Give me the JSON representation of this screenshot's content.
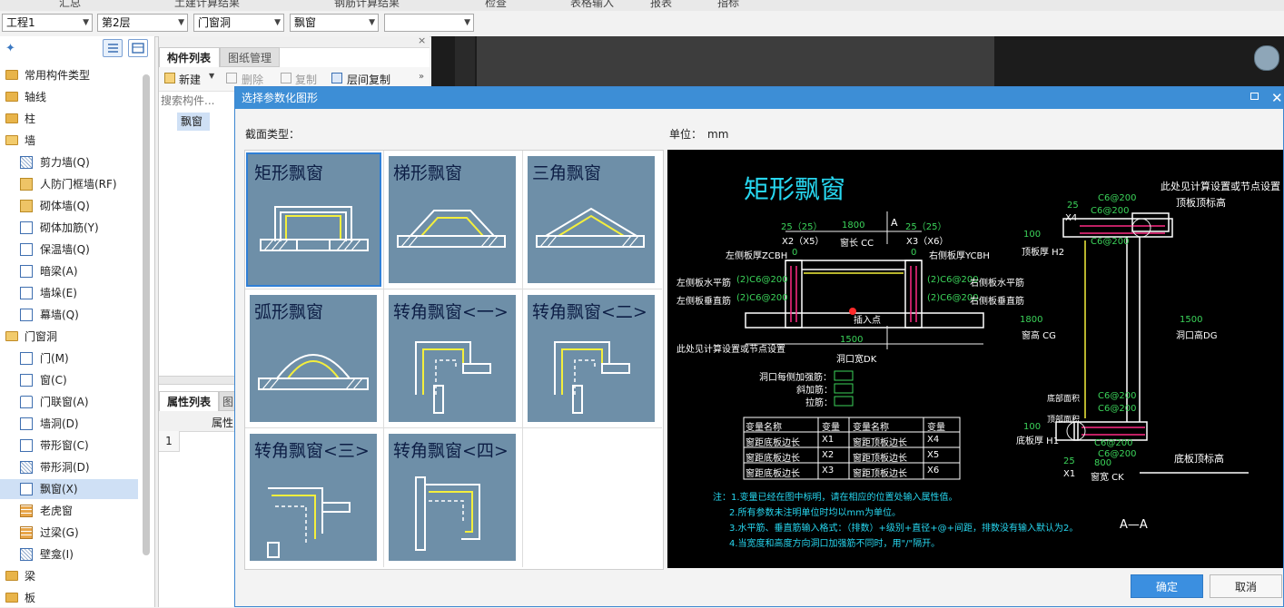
{
  "menubar": [
    "汇总",
    "土建计算结果",
    "钢筋计算结果",
    "检查",
    "表格输入",
    "报表",
    "指标"
  ],
  "toolbar": {
    "combos": [
      "工程1",
      "第2层",
      "门窗洞",
      "飘窗",
      ""
    ]
  },
  "sidebar": {
    "items": [
      {
        "label": "常用构件类型",
        "kind": "folder"
      },
      {
        "label": "轴线",
        "kind": "folder"
      },
      {
        "label": "柱",
        "kind": "folder"
      },
      {
        "label": "墙",
        "kind": "folder-open"
      },
      {
        "label": "剪力墙(Q)",
        "kind": "child"
      },
      {
        "label": "人防门框墙(RF)",
        "kind": "child"
      },
      {
        "label": "砌体墙(Q)",
        "kind": "child"
      },
      {
        "label": "砌体加筋(Y)",
        "kind": "child"
      },
      {
        "label": "保温墙(Q)",
        "kind": "child"
      },
      {
        "label": "暗梁(A)",
        "kind": "child"
      },
      {
        "label": "墙垛(E)",
        "kind": "child"
      },
      {
        "label": "幕墙(Q)",
        "kind": "child"
      },
      {
        "label": "门窗洞",
        "kind": "folder-open"
      },
      {
        "label": "门(M)",
        "kind": "child"
      },
      {
        "label": "窗(C)",
        "kind": "child"
      },
      {
        "label": "门联窗(A)",
        "kind": "child"
      },
      {
        "label": "墙洞(D)",
        "kind": "child"
      },
      {
        "label": "带形窗(C)",
        "kind": "child"
      },
      {
        "label": "带形洞(D)",
        "kind": "child"
      },
      {
        "label": "飘窗(X)",
        "kind": "child",
        "selected": true
      },
      {
        "label": "老虎窗",
        "kind": "child"
      },
      {
        "label": "过梁(G)",
        "kind": "child"
      },
      {
        "label": "壁龛(I)",
        "kind": "child"
      },
      {
        "label": "梁",
        "kind": "folder"
      },
      {
        "label": "板",
        "kind": "folder"
      }
    ]
  },
  "component_panel": {
    "tabs": [
      "构件列表",
      "图纸管理"
    ],
    "toolbar": [
      "新建",
      "删除",
      "复制",
      "层间复制"
    ],
    "search_placeholder": "搜索构件...",
    "items": [
      "飘窗"
    ]
  },
  "property_panel": {
    "tabs": [
      "属性列表",
      "图"
    ],
    "header": "属性",
    "row_number": "1"
  },
  "dialog": {
    "title": "选择参数化图形",
    "section_label": "截面类型：",
    "unit_label": "单位：",
    "unit_value": "mm",
    "shapes": [
      "矩形飘窗",
      "梯形飘窗",
      "三角飘窗",
      "弧形飘窗",
      "转角飘窗<一>",
      "转角飘窗<二>",
      "转角飘窗<三>",
      "转角飘窗<四>"
    ],
    "selected_shape": "矩形飘窗",
    "ok_button": "确定",
    "cancel_button": "取消"
  },
  "preview": {
    "title": "矩形飘窗",
    "top_right_note": "此处见计算设置或节点设置",
    "top_slab_label": "顶板顶标高",
    "labels": {
      "dim_25_25": "25（25）",
      "x2x5": "X2（X5）",
      "dim_1800": "1800",
      "cc": "窗长 CC",
      "x3x6": "X3（X6）",
      "section_a": "A",
      "left_thick": "左侧板厚ZCBH",
      "right_thick": "右侧板厚YCBH",
      "zero": "0",
      "left_h": "左侧板水平筋",
      "left_v": "左侧板垂直筋",
      "right_h": "右侧板水平筋",
      "right_v": "右侧板垂直筋",
      "rebar": "(2)C6@200",
      "insert_point": "插入点",
      "dim_1500": "1500",
      "dk": "洞口宽DK",
      "bottom_note": "此处见计算设置或节点设置",
      "add_each": "洞口每侧加强筋：",
      "add_diag": "斜加筋：",
      "tie": "拉筋：",
      "c6": "C6@200",
      "x4": "X4",
      "x1": "X1",
      "d25": "25",
      "d100": "100",
      "top_h": "顶板厚 H2",
      "cg_val": "1800",
      "cg": "窗高 CG",
      "dg_val": "1500",
      "dg": "洞口高DG",
      "bot_h": "底板厚 H1",
      "dim_800": "800",
      "ck": "窗宽 CK",
      "bottom_slab": "底板顶标高",
      "aa": "A—A",
      "tag1": "底部面积",
      "tag2": "顶部面积"
    },
    "table": {
      "headers": [
        "变量名称",
        "变量",
        "变量名称",
        "变量"
      ],
      "rows": [
        [
          "窗距底板边长",
          "X1",
          "窗距顶板边长",
          "X4"
        ],
        [
          "窗距底板边长",
          "X2",
          "窗距顶板边长",
          "X5"
        ],
        [
          "窗距底板边长",
          "X3",
          "窗距顶板边长",
          "X6"
        ]
      ]
    },
    "notes": [
      "注：1.变量已经在图中标明，请在相应的位置处输入属性值。",
      "2.所有参数未注明单位时均以mm为单位。",
      "3.水平筋、垂直筋输入格式：（排数）+级别+直径+@+间距，排数没有输入默认为2。",
      "4.当宽度和高度方向洞口加强筋不同时，用\"/\"隔开。"
    ]
  }
}
